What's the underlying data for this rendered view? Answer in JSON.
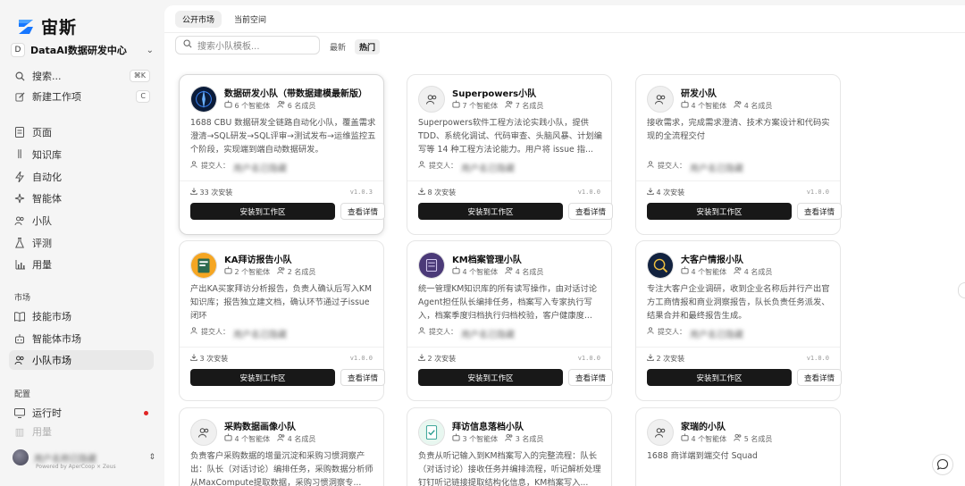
{
  "app": {
    "name": "宙斯",
    "powered_by": "Powered by AperCoop × Zeus"
  },
  "workspace": {
    "badge": "D",
    "name": "DataAI数据研发中心"
  },
  "nav": {
    "search": {
      "label": "搜索...",
      "kbd": "⌘K"
    },
    "new_task": {
      "label": "新建工作项",
      "kbd": "C"
    },
    "items": [
      {
        "label": "页面",
        "icon": "page-icon"
      },
      {
        "label": "知识库",
        "icon": "library-icon"
      },
      {
        "label": "自动化",
        "icon": "bolt-icon"
      },
      {
        "label": "智能体",
        "icon": "agent-icon"
      },
      {
        "label": "小队",
        "icon": "team-icon"
      },
      {
        "label": "评测",
        "icon": "flask-icon"
      },
      {
        "label": "用量",
        "icon": "bar-chart-icon"
      }
    ],
    "section_market": "市场",
    "market_items": [
      {
        "label": "技能市场",
        "icon": "book-icon"
      },
      {
        "label": "智能体市场",
        "icon": "robot-icon"
      },
      {
        "label": "小队市场",
        "icon": "team-icon",
        "active": true
      }
    ],
    "section_config": "配置",
    "config_items": [
      {
        "label": "运行时",
        "icon": "monitor-icon"
      },
      {
        "label": "用量",
        "icon": "bar-chart-icon"
      }
    ]
  },
  "user": {
    "name": "用户名称已隐藏"
  },
  "tabs": [
    {
      "label": "公开市场",
      "active": true
    },
    {
      "label": "当前空间",
      "active": false
    }
  ],
  "search": {
    "placeholder": "搜索小队模板..."
  },
  "sort": [
    {
      "label": "最新",
      "active": false
    },
    {
      "label": "热门",
      "active": true
    }
  ],
  "card_labels": {
    "install": "安装到工作区",
    "detail": "查看详情",
    "submitter": "提交人："
  },
  "cards": [
    {
      "title": "数据研发小队（带数据建模最新版）",
      "agents": "6 个智能体",
      "members": "6 名成员",
      "desc": "1688 CBU 数据研发全链路自动化小队，覆盖需求澄清→SQL研发→SQL评审→测试发布→运维监控五个阶段，实现端到端自动数据研发。",
      "submitter": "用户名已隐藏",
      "installs": "33 次安装",
      "version": "v1.0.3",
      "icon": "globe-icon"
    },
    {
      "title": "Superpowers小队",
      "agents": "7 个智能体",
      "members": "7 名成员",
      "desc": "Superpowers软件工程方法论实践小队，提供 TDD、系统化调试、代码审查、头脑风暴、计划编写等 14 种工程方法论能力。用户将 issue 指...",
      "submitter": "用户名已隐藏",
      "installs": "8 次安装",
      "version": "v1.0.0",
      "icon": "user-group-icon"
    },
    {
      "title": "研发小队",
      "agents": "4 个智能体",
      "members": "4 名成员",
      "desc": "接收需求，完成需求澄清、技术方案设计和代码实现的全流程交付",
      "submitter": "用户名已隐藏",
      "installs": "4 次安装",
      "version": "v1.0.0",
      "icon": "user-group-icon"
    },
    {
      "title": "KA拜访报告小队",
      "agents": "2 个智能体",
      "members": "2 名成员",
      "desc": "产出KA买家拜访分析报告，负责人确认后写入KM知识库；报告独立建文档，确认环节通过子issue闭环",
      "submitter": "用户名已隐藏",
      "installs": "3 次安装",
      "version": "v1.0.0",
      "icon": "report-icon"
    },
    {
      "title": "KM档案管理小队",
      "agents": "4 个智能体",
      "members": "4 名成员",
      "desc": "统一管理KM知识库的所有读写操作，由对话讨论Agent担任队长编排任务，档案写入专家执行写入，档案季度归档执行归档校验，客户健康度...",
      "submitter": "用户名已隐藏",
      "installs": "2 次安装",
      "version": "v1.0.0",
      "icon": "archive-icon"
    },
    {
      "title": "大客户情报小队",
      "agents": "4 个智能体",
      "members": "4 名成员",
      "desc": "专注大客户企业调研，收到企业名称后并行产出官方工商情报和商业洞察报告，队长负责任务派发、结果合并和最终报告生成。",
      "submitter": "用户名已隐藏",
      "installs": "2 次安装",
      "version": "v1.0.0",
      "icon": "intel-icon"
    },
    {
      "title": "采购数据画像小队",
      "agents": "4 个智能体",
      "members": "4 名成员",
      "desc": "负责客户采购数据的增量沉淀和采购习惯洞察产出：队长（对话讨论）编排任务，采购数据分析师从MaxCompute提取数据，采购习惯洞察专...",
      "icon": "user-group-icon"
    },
    {
      "title": "拜访信息落档小队",
      "agents": "3 个智能体",
      "members": "3 名成员",
      "desc": "负责从听记输入到KM档案写入的完整流程：队长（对话讨论）接收任务并编排流程，听记解析处理钉钉听记链接提取结构化信息，KM档案写入...",
      "icon": "file-check-icon"
    },
    {
      "title": "家瑞的小队",
      "agents": "4 个智能体",
      "members": "5 名成员",
      "desc": "1688 商详端到端交付 Squad",
      "icon": "user-group-icon"
    }
  ]
}
